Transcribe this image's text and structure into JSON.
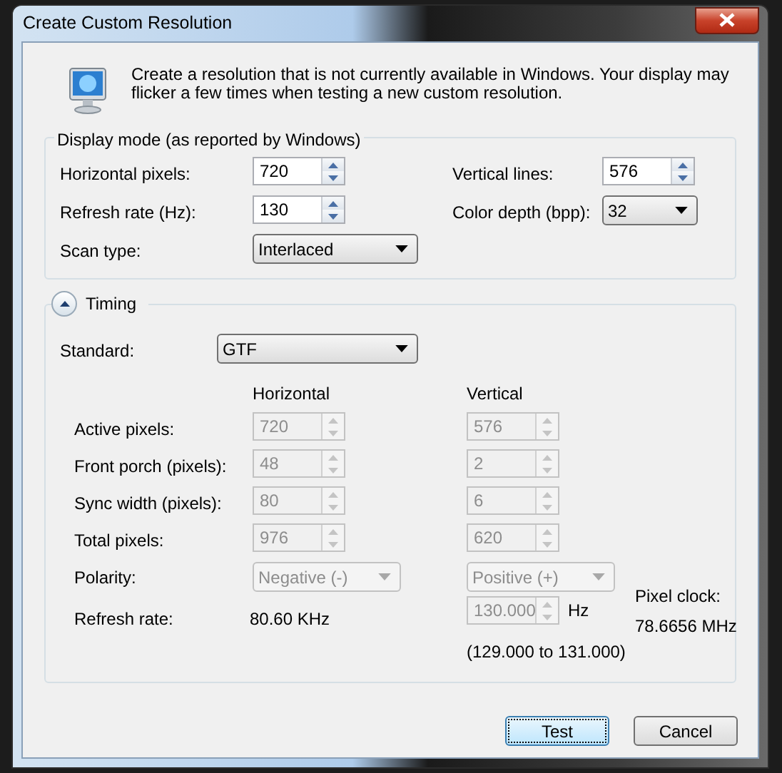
{
  "window": {
    "title": "Create Custom Resolution"
  },
  "intro": {
    "text": "Create a resolution that is not currently available in Windows. Your display may flicker a few times when testing a new custom resolution."
  },
  "display_mode": {
    "title": "Display mode (as reported by Windows)",
    "fields": [
      {
        "kind": "spin",
        "label": "Horizontal pixels:",
        "value": "720"
      },
      {
        "kind": "spin",
        "label": "Vertical lines:",
        "value": "576"
      },
      {
        "kind": "spin",
        "label": "Refresh rate (Hz):",
        "value": "130"
      },
      {
        "kind": "dropdown",
        "label": "Color depth (bpp):",
        "value": "32"
      },
      {
        "kind": "dropdown",
        "label": "Scan type:",
        "value": "Interlaced"
      }
    ]
  },
  "timing": {
    "title": "Timing",
    "expanded": true,
    "standard": {
      "label": "Standard:",
      "value": "GTF"
    },
    "columns": [
      "Horizontal",
      "Vertical"
    ],
    "rows": [
      {
        "kind": "spin",
        "label": "Active pixels:",
        "horizontal": "720",
        "vertical": "576",
        "disabled": true
      },
      {
        "kind": "spin",
        "label": "Front porch (pixels):",
        "horizontal": "48",
        "vertical": "2",
        "disabled": true
      },
      {
        "kind": "spin",
        "label": "Sync width (pixels):",
        "horizontal": "80",
        "vertical": "6",
        "disabled": true
      },
      {
        "kind": "spin",
        "label": "Total pixels:",
        "horizontal": "976",
        "vertical": "620",
        "disabled": true
      },
      {
        "kind": "dropdown",
        "label": "Polarity:",
        "horizontal": "Negative (-)",
        "vertical": "Positive (+)",
        "disabled": true
      }
    ],
    "refresh_rate": {
      "label": "Refresh rate:",
      "horizontal": "80.60 KHz",
      "vertical": "130.000",
      "unit": "Hz",
      "range": "(129.000 to 131.000)",
      "disabled": true
    },
    "pixel_clock": {
      "label": "Pixel clock:",
      "value": "78.6656 MHz"
    }
  },
  "buttons": [
    {
      "label": "Test",
      "focused": true
    },
    {
      "label": "Cancel",
      "focused": false
    }
  ]
}
